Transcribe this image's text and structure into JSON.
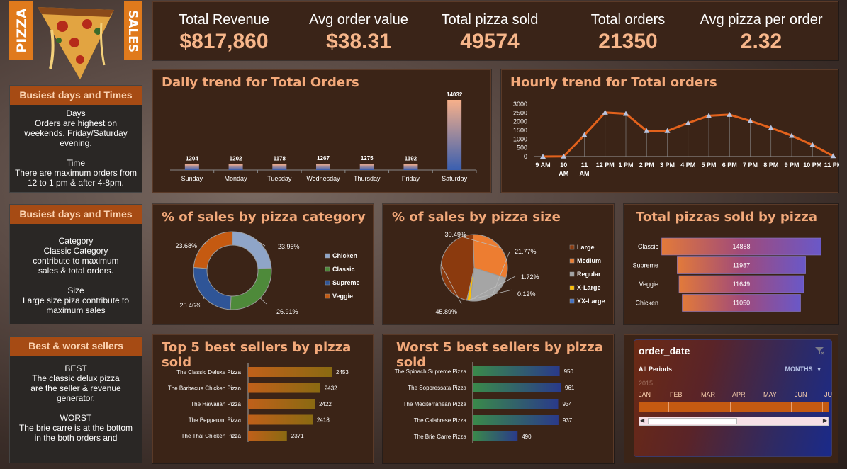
{
  "logo": {
    "left": "PIZZA",
    "right": "SALES"
  },
  "kpis": [
    {
      "label": "Total Revenue",
      "value": "$817,860"
    },
    {
      "label": "Avg order value",
      "value": "$38.31"
    },
    {
      "label": "Total pizza sold",
      "value": "49574"
    },
    {
      "label": "Total orders",
      "value": "21350"
    },
    {
      "label": "Avg pizza per order",
      "value": "2.32"
    }
  ],
  "side": [
    {
      "title": "Busiest days and Times",
      "lines": [
        "Days",
        "Orders are highest on",
        "weekends. Friday/Saturday",
        "evening.",
        "",
        "Time",
        "There are maximum orders from",
        "12 to 1 pm & after 4-8pm."
      ]
    },
    {
      "title": "Busiest days and Times",
      "lines": [
        "Category",
        "Classic Category",
        "contribute to maximum",
        "sales & total orders.",
        "",
        "Size",
        "Large size piza contribute to",
        "maximum sales"
      ]
    },
    {
      "title": "Best & worst sellers",
      "lines": [
        "BEST",
        "The classic delux pizza",
        "are the seller & revenue",
        "generator.",
        "",
        "WORST",
        "The brie carre is at the bottom",
        "in the both orders and"
      ]
    }
  ],
  "titles": {
    "daily": "Daily trend for Total Orders",
    "hourly": "Hourly trend for Total orders",
    "category": "% of sales by pizza category",
    "size": "% of sales by pizza size",
    "pizzas": "Total pizzas sold by pizza",
    "top5": "Top 5 best sellers by pizza sold",
    "worst5": "Worst 5 best sellers by pizza sold"
  },
  "slicer": {
    "title": "order_date",
    "period": "All Periods",
    "unit": "MONTHS",
    "year": "2015",
    "months": [
      "JAN",
      "FEB",
      "MAR",
      "APR",
      "MAY",
      "JUN",
      "JU"
    ]
  },
  "chart_data": [
    {
      "id": "daily",
      "type": "bar",
      "categories": [
        "Sunday",
        "Monday",
        "Tuesday",
        "Wednesday",
        "Thursday",
        "Friday",
        "Saturday"
      ],
      "values": [
        1204,
        1202,
        1178,
        1267,
        1275,
        1192,
        14032
      ],
      "colors": {
        "top": "#f7b08a",
        "bottom": "#3a5fb0"
      }
    },
    {
      "id": "hourly",
      "type": "line",
      "categories": [
        "9 AM",
        "10 AM",
        "11 AM",
        "12 PM",
        "1 PM",
        "2 PM",
        "3 PM",
        "4 PM",
        "5 PM",
        "6 PM",
        "7 PM",
        "8 PM",
        "9 PM",
        "10 PM",
        "11 PM"
      ],
      "values": [
        1,
        8,
        1231,
        2520,
        2455,
        1472,
        1468,
        1920,
        2336,
        2399,
        2039,
        1642,
        1198,
        663,
        28
      ],
      "ylim": [
        0,
        3000
      ],
      "yticks": [
        0,
        500,
        1000,
        1500,
        2000,
        2500,
        3000
      ],
      "color": "#e2621c"
    },
    {
      "id": "category",
      "type": "pie",
      "donut": true,
      "labels": [
        "Chicken",
        "Classic",
        "Supreme",
        "Veggie"
      ],
      "values": [
        23.96,
        26.91,
        25.46,
        23.68
      ],
      "display": [
        "23.96%",
        "26.91%",
        "25.46%",
        "23.68%"
      ],
      "colors": [
        "#8fa5c8",
        "#4e8a3a",
        "#2f5597",
        "#c55a11"
      ]
    },
    {
      "id": "size",
      "type": "pie",
      "labels": [
        "Large",
        "Medium",
        "Regular",
        "X-Large",
        "XX-Large"
      ],
      "values": [
        45.89,
        30.49,
        21.77,
        1.72,
        0.12
      ],
      "display": [
        "45.89%",
        "30.49%",
        "21.77%",
        "1.72%",
        "0.12%"
      ],
      "colors": [
        "#8b3a0e",
        "#ed7d31",
        "#a5a5a5",
        "#ffc000",
        "#4472c4"
      ]
    },
    {
      "id": "pizzas",
      "type": "bar",
      "orientation": "horizontal",
      "categories": [
        "Classic",
        "Supreme",
        "Veggie",
        "Chicken"
      ],
      "values": [
        14888,
        11987,
        11649,
        11050
      ]
    },
    {
      "id": "top5",
      "type": "bar",
      "orientation": "horizontal",
      "categories": [
        "The Classic Deluxe Pizza",
        "The Barbecue Chicken Pizza",
        "The Hawaiian Pizza",
        "The Pepperoni Pizza",
        "The Thai Chicken Pizza"
      ],
      "values": [
        2453,
        2432,
        2422,
        2418,
        2371
      ]
    },
    {
      "id": "worst5",
      "type": "bar",
      "orientation": "horizontal",
      "categories": [
        "The Spinach Supreme Pizza",
        "The Soppressata Pizza",
        "The Mediterranean Pizza",
        "The Calabrese Pizza",
        "The Brie Carre Pizza"
      ],
      "values": [
        950,
        961,
        934,
        937,
        490
      ]
    }
  ]
}
